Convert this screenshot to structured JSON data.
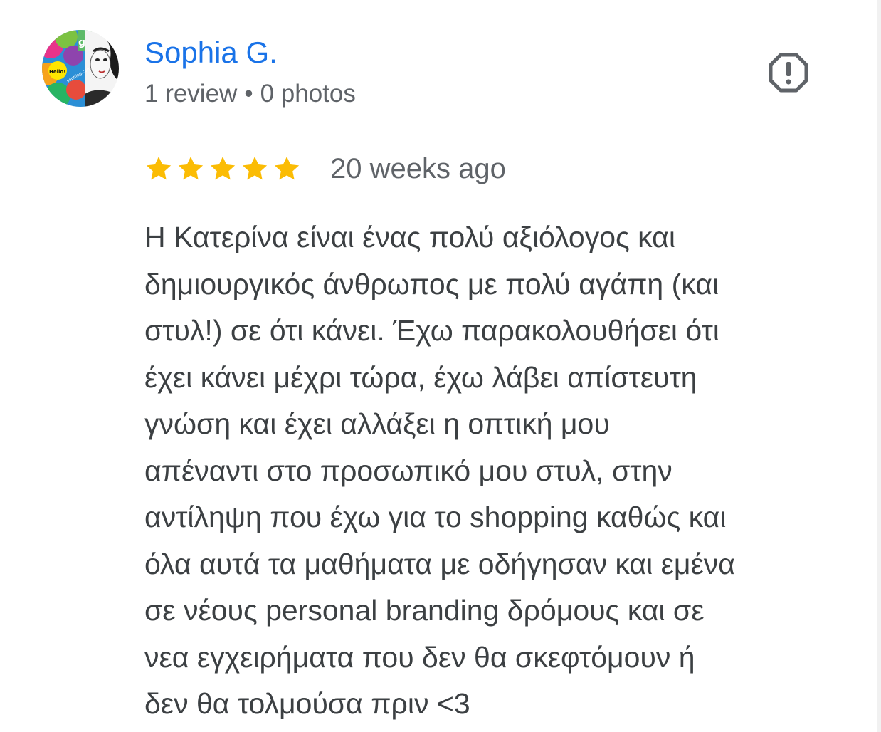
{
  "reviewer": {
    "name": "Sophia G.",
    "review_count": "1 review",
    "separator": "•",
    "photo_count": "0 photos",
    "avatar_texts": {
      "badge": "g",
      "hello": "Hello!",
      "site": "sophiag.com"
    }
  },
  "report": {
    "icon": "report-octagon-icon",
    "color": "#5f6368"
  },
  "review": {
    "rating": 5,
    "max_rating": 5,
    "star_color": "#fbbc04",
    "time": "20 weeks ago",
    "text_lines": [
      "Η Κατερίνα είναι ένας πολύ αξιόλογος και",
      "δημιουργικός άνθρωπος με πολύ αγάπη (και",
      "στυλ!) σε ότι κάνει. Έχω παρακολουθήσει ότι",
      "έχει κάνει μέχρι τώρα, έχω λάβει απίστευτη",
      "γνώση και έχει αλλάξει η οπτική μου",
      "απέναντι στο προσωπικό μου στυλ, στην",
      "αντίληψη που έχω για το shopping καθώς και",
      "όλα αυτά τα μαθήματα με οδήγησαν και εμένα",
      "σε νέους personal branding δρόμους και σε",
      "νεα εγχειρήματα που δεν θα σκεφτόμουν ή",
      "δεν θα τολμούσα πριν <3"
    ]
  },
  "colors": {
    "name": "#1a73e8",
    "meta": "#5f6368",
    "body_text": "#3c4043"
  }
}
